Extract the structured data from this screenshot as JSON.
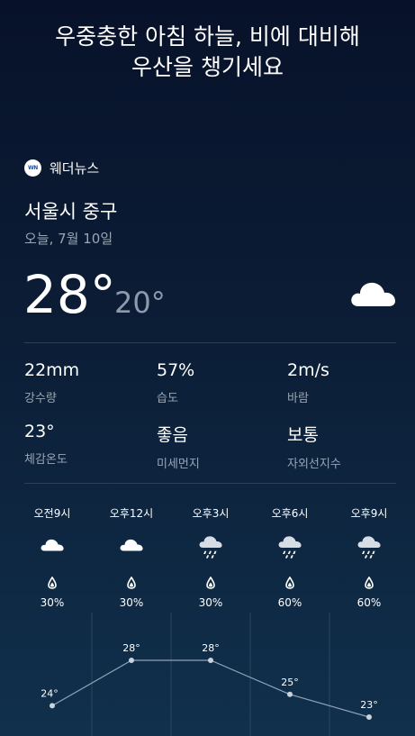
{
  "headline": {
    "line1": "우중충한 아침 하늘, 비에 대비해",
    "line2": "우산을 챙기세요"
  },
  "brand": {
    "logo_text": "WN",
    "name": "웨더뉴스"
  },
  "location": "서울시 중구",
  "date": "오늘, 7월 10일",
  "current": {
    "high": "28°",
    "low": "20°",
    "icon": "cloud-icon"
  },
  "stats": [
    {
      "value": "22mm",
      "label": "강수량"
    },
    {
      "value": "57%",
      "label": "습도"
    },
    {
      "value": "2m/s",
      "label": "바람"
    },
    {
      "value": "23°",
      "label": "체감온도"
    },
    {
      "value": "좋음",
      "label": "미세먼지"
    },
    {
      "value": "보통",
      "label": "자외선지수"
    }
  ],
  "hourly": [
    {
      "time": "오전9시",
      "icon": "cloud-icon",
      "precip": "30%",
      "temp": "24°",
      "temp_value": 24
    },
    {
      "time": "오후12시",
      "icon": "cloud-icon",
      "precip": "30%",
      "temp": "28°",
      "temp_value": 28
    },
    {
      "time": "오후3시",
      "icon": "rain-cloud-icon",
      "precip": "30%",
      "temp": "28°",
      "temp_value": 28
    },
    {
      "time": "오후6시",
      "icon": "rain-cloud-icon",
      "precip": "60%",
      "temp": "25°",
      "temp_value": 25
    },
    {
      "time": "오후9시",
      "icon": "rain-cloud-icon",
      "precip": "60%",
      "temp": "23°",
      "temp_value": 23
    }
  ],
  "colors": {
    "background_top": "#07122a",
    "background_bottom": "#10304c",
    "secondary_text": "#9aa6b5",
    "graph_line": "#8fa3b8"
  }
}
